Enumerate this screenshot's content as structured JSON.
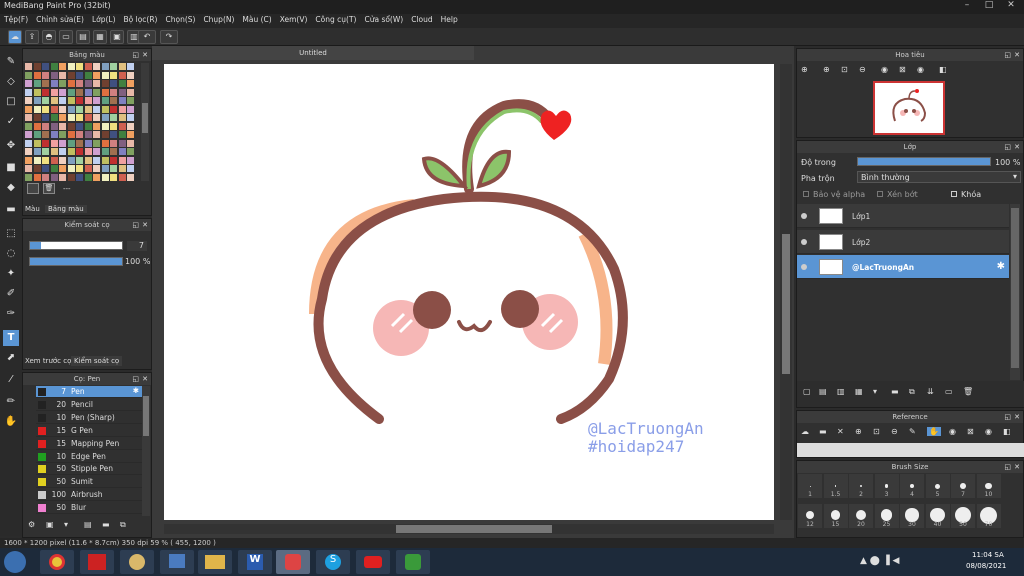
{
  "app": {
    "title": "MediBang Paint Pro (32bit)"
  },
  "menu": [
    "Tệp(F)",
    "Chỉnh sửa(E)",
    "Lớp(L)",
    "Bộ lọc(R)",
    "Chọn(S)",
    "Chụp(N)",
    "Màu (C)",
    "Xem(V)",
    "Công cụ(T)",
    "Cửa sổ(W)",
    "Cloud",
    "Help"
  ],
  "palette": {
    "title": "Bảng màu",
    "tab_color": "Màu",
    "tab_palette": "Bảng màu",
    "dash": "---"
  },
  "brush_control": {
    "title": "Kiểm soát cọ",
    "size": "7",
    "opacity": "100 %",
    "tab_preview": "Xem trước cọ",
    "tab_control": "Kiểm soát cọ"
  },
  "brushes": {
    "title": "Cọ: Pen",
    "items": [
      {
        "size": "7",
        "name": "Pen",
        "color": "#222222",
        "selected": true
      },
      {
        "size": "20",
        "name": "Pencil",
        "color": "#222222"
      },
      {
        "size": "10",
        "name": "Pen (Sharp)",
        "color": "#222222"
      },
      {
        "size": "15",
        "name": "G Pen",
        "color": "#e02020"
      },
      {
        "size": "15",
        "name": "Mapping Pen",
        "color": "#e02020"
      },
      {
        "size": "10",
        "name": "Edge Pen",
        "color": "#20a020"
      },
      {
        "size": "50",
        "name": "Stipple Pen",
        "color": "#e0d020"
      },
      {
        "size": "50",
        "name": "Sumit",
        "color": "#e0d020"
      },
      {
        "size": "100",
        "name": "Airbrush",
        "color": "#cccccc"
      },
      {
        "size": "50",
        "name": "Blur",
        "color": "#f080d0"
      }
    ]
  },
  "canvas": {
    "tab_label": "Untitled",
    "watermark1": "@LacTruongAn",
    "watermark2": "#hoidap247"
  },
  "status": {
    "size": "1600 * 1200 pixel  (11.6 * 8.7cm)  350 dpi  59 %  ( 455, 1200 )"
  },
  "navigator": {
    "title": "Hoa tiêu"
  },
  "layers": {
    "title": "Lớp",
    "opacity_label": "Độ trong",
    "opacity_value": "100 %",
    "blend_label": "Pha trộn",
    "blend_value": "Bình thường",
    "protect_alpha": "Bảo vệ alpha",
    "clipping": "Xén bớt",
    "lock": "Khóa",
    "items": [
      {
        "name": "Lớp1",
        "selected": false
      },
      {
        "name": "Lớp2",
        "selected": false
      },
      {
        "name": "@LacTruongAn",
        "selected": true
      }
    ]
  },
  "reference": {
    "title": "Reference"
  },
  "brush_size": {
    "title": "Brush Size",
    "row1": [
      "1",
      "1.5",
      "2",
      "3",
      "4",
      "5",
      "7",
      "10"
    ],
    "row2": [
      "12",
      "15",
      "20",
      "25",
      "30",
      "40",
      "50",
      "70"
    ]
  },
  "taskbar": {
    "time": "11:04 SA",
    "date": "08/08/2021"
  },
  "colors": {
    "accent": "#5a95d4",
    "stroke": "#8b4f47",
    "leaf": "#8cc46a",
    "cheek": "#f6b7b6",
    "peach": "#f7b48a",
    "heart": "#ee2222"
  }
}
